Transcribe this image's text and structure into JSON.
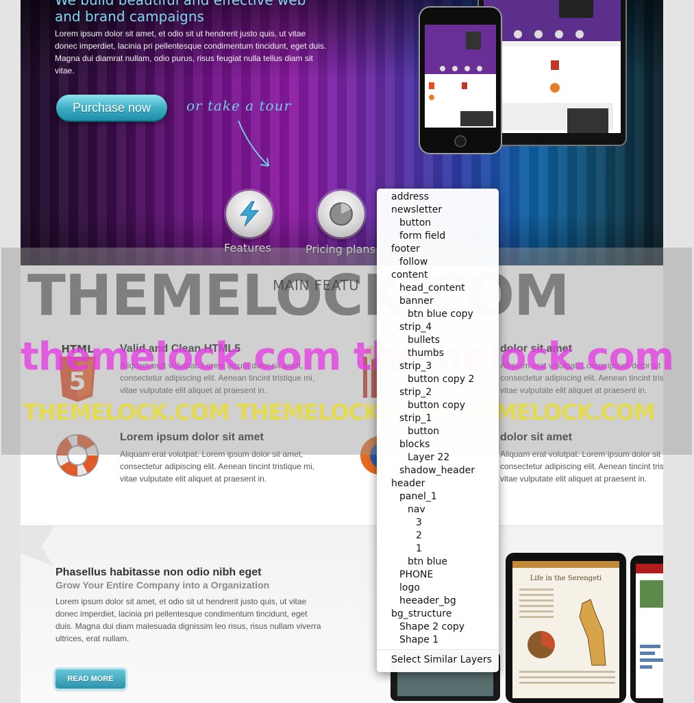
{
  "hero": {
    "headline_line1": "We build beautiful and effective web",
    "headline_line2": "and brand campaigns",
    "body": "Lorem ipsum dolor sit amet, et odio sit ut hendrerit justo quis, ut vitae donec imperdiet, lacinia pri pellentesque condimentum tincidunt, eget duis. Magna dui diamrat nullam, odio purus, risus feugiat nulla tellus diam sit vitae.",
    "purchase_label": "Purchase now",
    "tour_label": "or take a tour",
    "features_label": "Features",
    "pricing_label": "Pricing plans"
  },
  "main_features": {
    "title": "MAIN FEATU",
    "items": [
      {
        "title": "Valid and Clean HTML5",
        "text": "Aliquam erat volutpat. Lorem ipsum dolor sit amet, consectetur adipiscing elit. Aenean tincint tristique mi, vitae vulputate elit aliquet at praesent in.",
        "icon_text": "HTML"
      },
      {
        "title": "dolor sit amet",
        "text": "Aliquam erat volutpat. Lorem ipsum dolor sit amet, consectetur adipiscing elit. Aenean tincint tristique mi, vitae vulputate elit aliquet at praesent in."
      },
      {
        "title": "Lorem ipsum dolor sit amet",
        "text": "Aliquam erat volutpat. Lorem ipsum dolor sit amet, consectetur adipiscing elit. Aenean tincint tristique mi, vitae vulputate elit aliquet at praesent in."
      },
      {
        "title": "dolor sit amet",
        "text": "Aliquam erat volutpat. Lorem ipsum dolor sit amet, consectetur adipiscing elit. Aenean tincint tristique mi, vitae vulputate elit aliquet at praesent in."
      }
    ]
  },
  "lower": {
    "title": "Phasellus habitasse non odio nibh eget",
    "subtitle": "Grow Your Entire Company into a Organization",
    "body": "Lorem ipsum dolor sit amet, et odio sit ut hendrerit justo quis, ut vitae donec imperdiet, lacinia pri pellentesque condimentum tincidunt, eget duis. Magna dui diam malesuada dignissim leo risus, risus nullam viverra ultrices, erat nullam.",
    "read_more": "READ MORE"
  },
  "watermark": {
    "line1": "THEMELOCK.COM",
    "line2": "themelock.com themelock.com",
    "line3": "THEMELOCK.COM THEMELOCK.COM THEMELOCK.COM"
  },
  "layers_menu": {
    "items": [
      {
        "label": "address",
        "level": 0
      },
      {
        "label": "newsletter",
        "level": 0
      },
      {
        "label": "button",
        "level": 1
      },
      {
        "label": "form field",
        "level": 1
      },
      {
        "label": "footer",
        "level": 0
      },
      {
        "label": "follow",
        "level": 1
      },
      {
        "label": "content",
        "level": 0
      },
      {
        "label": "head_content",
        "level": 1
      },
      {
        "label": "banner",
        "level": 1
      },
      {
        "label": "btn blue copy",
        "level": 2
      },
      {
        "label": "strip_4",
        "level": 1
      },
      {
        "label": "bullets",
        "level": 2
      },
      {
        "label": "thumbs",
        "level": 2
      },
      {
        "label": "strip_3",
        "level": 1
      },
      {
        "label": "button copy 2",
        "level": 2
      },
      {
        "label": "strip_2",
        "level": 1
      },
      {
        "label": "button copy",
        "level": 2
      },
      {
        "label": "strip_1",
        "level": 1
      },
      {
        "label": "button",
        "level": 2
      },
      {
        "label": "blocks",
        "level": 1
      },
      {
        "label": "Layer 22",
        "level": 2
      },
      {
        "label": "shadow_header",
        "level": 1
      },
      {
        "label": "header",
        "level": 0
      },
      {
        "label": "panel_1",
        "level": 1
      },
      {
        "label": "nav",
        "level": 2
      },
      {
        "label": "3",
        "level": 3
      },
      {
        "label": "2",
        "level": 3
      },
      {
        "label": "1",
        "level": 3
      },
      {
        "label": "btn blue",
        "level": 2
      },
      {
        "label": "PHONE",
        "level": 1
      },
      {
        "label": "logo",
        "level": 1
      },
      {
        "label": "heeader_bg",
        "level": 1
      },
      {
        "label": "bg_structure",
        "level": 0
      },
      {
        "label": "Shape 2 copy",
        "level": 1
      },
      {
        "label": "Shape 1",
        "level": 1
      }
    ],
    "footer_action": "Select Similar Layers"
  }
}
